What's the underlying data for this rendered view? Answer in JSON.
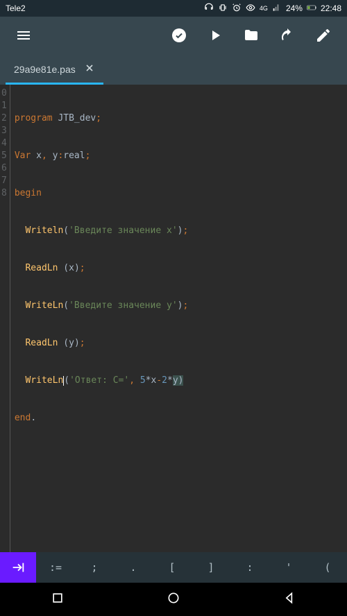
{
  "status": {
    "carrier": "Tele2",
    "signal_label": "4G",
    "battery_pct": "24%",
    "time": "22:48"
  },
  "tab": {
    "filename": "29a9e81e.pas"
  },
  "code": {
    "lines": [
      {
        "n": "0"
      },
      {
        "n": "1"
      },
      {
        "n": "2"
      },
      {
        "n": "3"
      },
      {
        "n": "4"
      },
      {
        "n": "5"
      },
      {
        "n": "6"
      },
      {
        "n": "7"
      },
      {
        "n": "8"
      }
    ],
    "l0": {
      "kw": "program",
      "id": " JTB_dev",
      "sc": ";"
    },
    "l1": {
      "kw": "Var",
      "id1": " x",
      "c": ",",
      "id2": " y",
      "col": ":",
      "ty": "real",
      "sc": ";"
    },
    "l2": {
      "kw": "begin"
    },
    "l3": {
      "fn": "  Writeln",
      "p1": "(",
      "s": "'Введите значение x'",
      "p2": ")",
      "sc": ";"
    },
    "l4": {
      "fn": "  ReadLn ",
      "p1": "(",
      "id": "x",
      "p2": ")",
      "sc": ";"
    },
    "l5": {
      "fn": "  WriteLn",
      "p1": "(",
      "s": "'Введите значение y'",
      "p2": ")",
      "sc": ";"
    },
    "l6": {
      "fn": "  ReadLn ",
      "p1": "(",
      "id": "y",
      "p2": ")",
      "sc": ";"
    },
    "l7": {
      "fn": "  WriteLn",
      "p1": "(",
      "s": "'Ответ: C='",
      "c": ",",
      "sp": " ",
      "n1": "5",
      "op1": "*",
      "v1": "x",
      "op2": "-",
      "n2": "2",
      "op3": "*",
      "v2": "y",
      "p2": ")"
    },
    "l8": {
      "kw": "end",
      "d": "."
    }
  },
  "symbar": {
    "k0": ":=",
    "k1": ";",
    "k2": ".",
    "k3": "[",
    "k4": "]",
    "k5": ":",
    "k6": "'",
    "k7": "("
  }
}
